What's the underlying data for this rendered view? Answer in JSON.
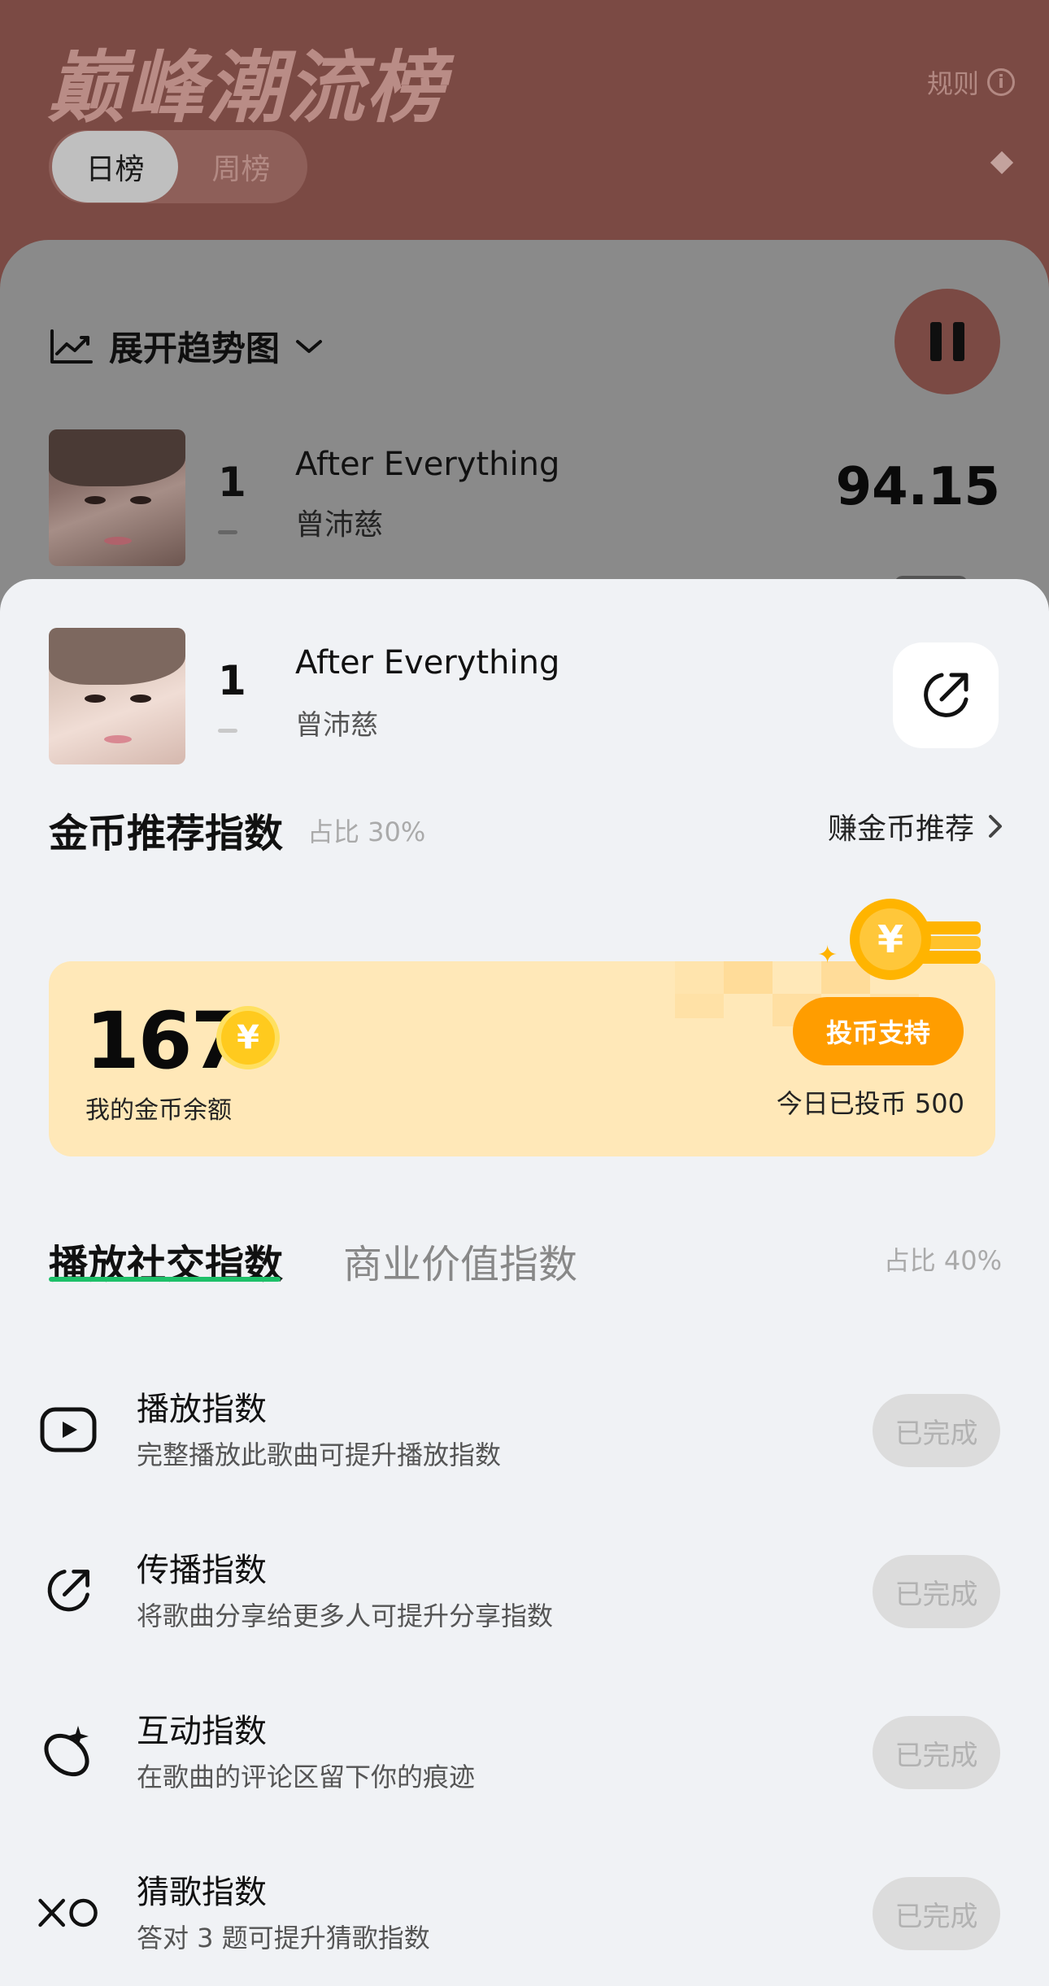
{
  "header": {
    "title": "巅峰潮流榜",
    "rules_label": "规则",
    "tabs": [
      {
        "label": "日榜",
        "active": true
      },
      {
        "label": "周榜",
        "active": false
      }
    ]
  },
  "trend": {
    "label": "展开趋势图"
  },
  "background_row": {
    "rank": "1",
    "title": "After Everything",
    "artist": "曾沛慈",
    "score": "94.15"
  },
  "sheet": {
    "song": {
      "rank": "1",
      "title": "After Everything",
      "artist": "曾沛慈"
    },
    "coin_section": {
      "title": "金币推荐指数",
      "ratio": "占比 30%",
      "earn_link": "赚金币推荐"
    },
    "coin_card": {
      "balance": "167",
      "balance_label": "我的金币余额",
      "coin_symbol": "¥",
      "vote_button": "投币支持",
      "today_label": "今日已投币 500"
    },
    "index_tabs": {
      "tabs": [
        {
          "label": "播放社交指数",
          "active": true
        },
        {
          "label": "商业价值指数",
          "active": false
        }
      ],
      "ratio": "占比 40%"
    },
    "tasks": [
      {
        "icon": "play-icon",
        "title": "播放指数",
        "desc": "完整播放此歌曲可提升播放指数",
        "button": "已完成"
      },
      {
        "icon": "share-icon",
        "title": "传播指数",
        "desc": "将歌曲分享给更多人可提升分享指数",
        "button": "已完成"
      },
      {
        "icon": "comment-sparkle-icon",
        "title": "互动指数",
        "desc": "在歌曲的评论区留下你的痕迹",
        "button": "已完成"
      },
      {
        "icon": "xo-icon",
        "title": "猜歌指数",
        "desc": "答对 3 题可提升猜歌指数",
        "button": "已完成"
      }
    ]
  },
  "colors": {
    "header_bg": "#7b4a44",
    "accent_green": "#1ec069",
    "vote_orange": "#ff9d00",
    "coin_card_bg": "#ffe8b8",
    "sheet_bg": "#f0f2f5"
  }
}
